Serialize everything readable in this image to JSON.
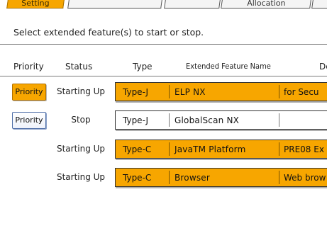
{
  "tabs": [
    {
      "label": "Setting",
      "active": true
    },
    {
      "label": "",
      "active": false
    },
    {
      "label": "",
      "active": false
    },
    {
      "label": "Allocation",
      "active": false
    },
    {
      "label": "",
      "active": false
    }
  ],
  "instruction": "Select extended feature(s) to start or stop.",
  "columns": {
    "priority": "Priority",
    "status": "Status",
    "type": "Type",
    "name": "Extended Feature Name",
    "desc": "De"
  },
  "rows": [
    {
      "priority": "Priority",
      "priority_on": true,
      "status": "Starting Up",
      "type": "Type-J",
      "name": "ELP NX",
      "desc": "for Secu",
      "on": true
    },
    {
      "priority": "Priority",
      "priority_on": false,
      "status": "Stop",
      "type": "Type-J",
      "name": "GlobalScan NX",
      "desc": "",
      "on": false
    },
    {
      "priority": "",
      "priority_on": false,
      "status": "Starting Up",
      "type": "Type-C",
      "name": "JavaTM Platform",
      "desc": "PRE08 Ex",
      "on": true
    },
    {
      "priority": "",
      "priority_on": false,
      "status": "Starting Up",
      "type": "Type-C",
      "name": "Browser",
      "desc": "Web brow",
      "on": true
    }
  ],
  "colors": {
    "accent": "#f7a600",
    "button_border": "#4f6fa8"
  }
}
